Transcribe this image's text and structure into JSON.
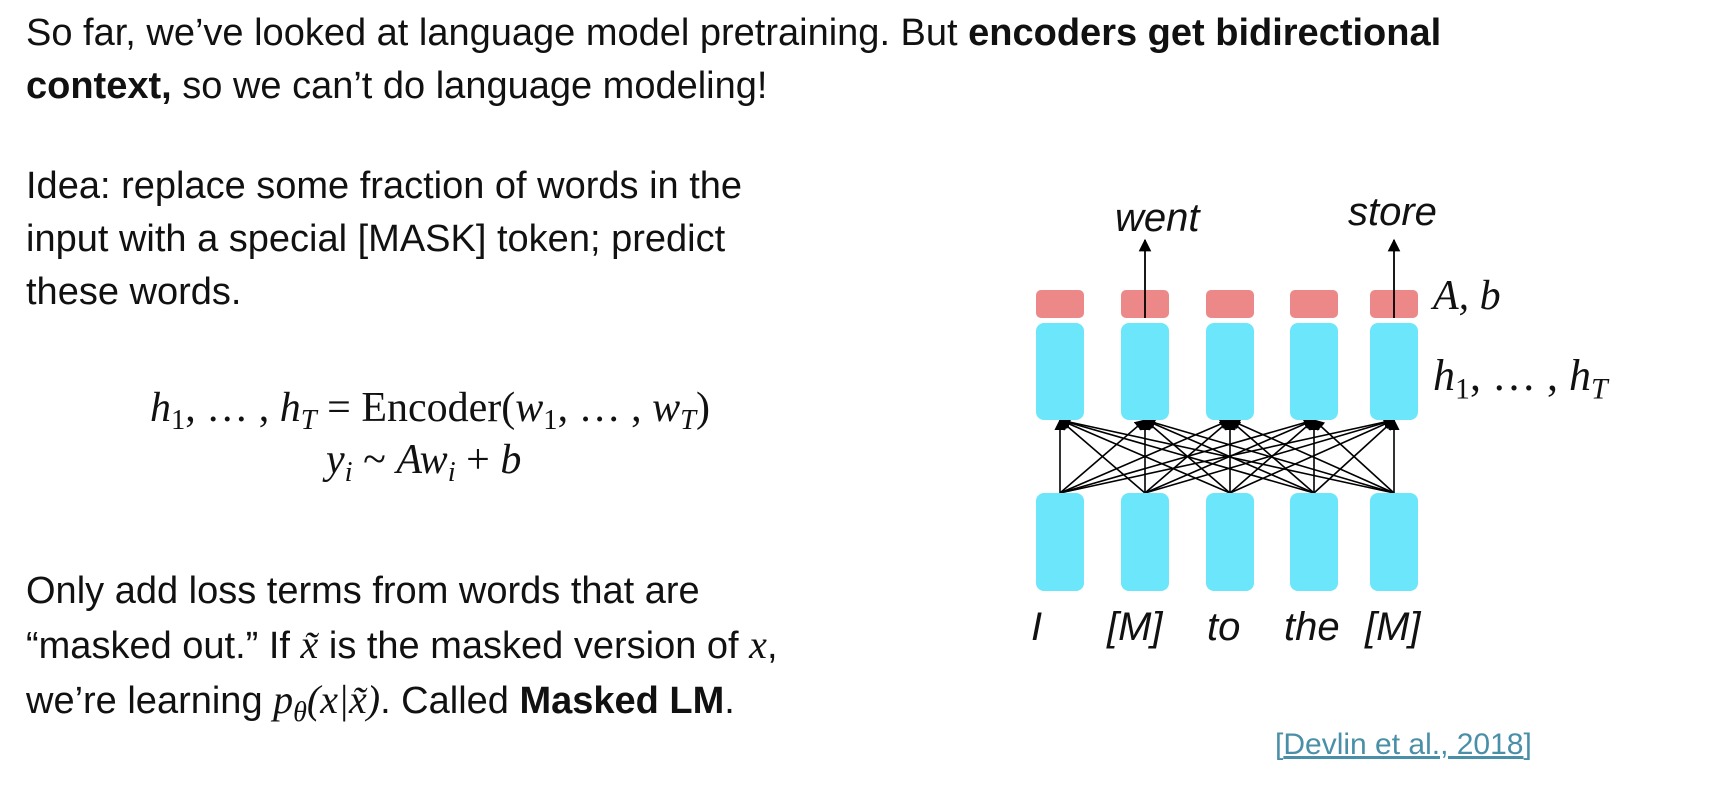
{
  "intro": {
    "line1_plain": "So far, we’ve looked at language model pretraining. But ",
    "line1_bold": "encoders get bidirectional",
    "line2_bold": "context,",
    "line2_plain": " so we can’t do language modeling!"
  },
  "idea": {
    "line1": "Idea: replace some fraction of words in the",
    "line2": "input with a special [MASK]  token; predict",
    "line3": "these words."
  },
  "equations": {
    "eq1_lhs_h": "h",
    "eq1_sub1": "1",
    "eq1_dots": ", … , ",
    "eq1_subT": "T",
    "eq1_eq": " = ",
    "eq1_encoder": "Encoder(",
    "eq1_w": "w",
    "eq1_close": ")",
    "eq2_y": "y",
    "eq2_subi": "i",
    "eq2_sim": " ~ ",
    "eq2_Aw": "Aw",
    "eq2_plus": " + ",
    "eq2_b": "b"
  },
  "loss": {
    "line1": "Only add loss terms from words that are",
    "line2_a": "“masked out.” If ",
    "line2_xt": "x̃",
    "line2_b": " is the masked version of ",
    "line2_x": "x",
    "line2_c": ",",
    "line3_a": "we’re learning ",
    "line3_p": "p",
    "line3_theta": "θ",
    "line3_args": "(x|x̃)",
    "line3_b": ". Called ",
    "line3_bold": "Masked LM",
    "line3_c": "."
  },
  "diagram": {
    "output_words": [
      "went",
      "store"
    ],
    "input_tokens": [
      "I",
      "[M]",
      "to",
      "the",
      "[M]"
    ],
    "label_Ab": "A, b",
    "label_h_h": "h",
    "label_h_sub1": "1",
    "label_h_dots": ", … , ",
    "label_h_subT": "T",
    "colors": {
      "hidden": "#6ce6fa",
      "output": "#ec8888",
      "line": "#000000"
    }
  },
  "citation": {
    "open": "[",
    "link": "Devlin et al., 2018",
    "close": "]"
  }
}
